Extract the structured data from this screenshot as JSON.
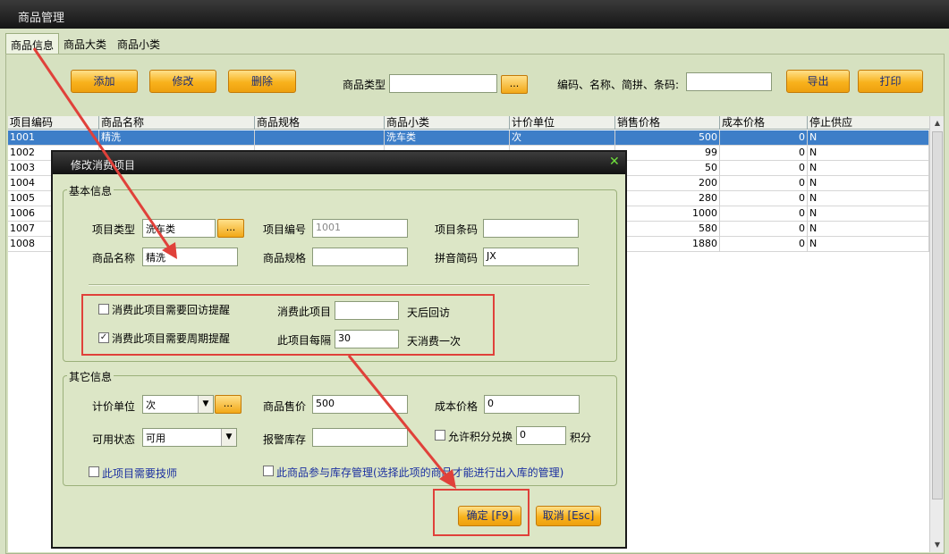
{
  "window": {
    "title": "商品管理"
  },
  "tabs": [
    "商品信息",
    "商品大类",
    "商品小类"
  ],
  "toolbar": {
    "add": "添加",
    "edit": "修改",
    "delete": "删除",
    "type_label": "商品类型",
    "browse": "...",
    "search_label": "编码、名称、简拼、条码:",
    "export": "导出",
    "print": "打印"
  },
  "grid": {
    "headers": [
      "项目编码",
      "商品名称",
      "商品规格",
      "商品小类",
      "计价单位",
      "销售价格",
      "成本价格",
      "停止供应"
    ],
    "rows": [
      [
        "1001",
        "精洗",
        "",
        "洗车类",
        "次",
        "500",
        "0",
        "N"
      ],
      [
        "1002",
        "",
        "",
        "",
        "",
        "99",
        "0",
        "N"
      ],
      [
        "1003",
        "",
        "",
        "",
        "",
        "50",
        "0",
        "N"
      ],
      [
        "1004",
        "",
        "",
        "",
        "",
        "200",
        "0",
        "N"
      ],
      [
        "1005",
        "",
        "",
        "",
        "",
        "280",
        "0",
        "N"
      ],
      [
        "1006",
        "",
        "",
        "",
        "",
        "1000",
        "0",
        "N"
      ],
      [
        "1007",
        "",
        "",
        "",
        "",
        "580",
        "0",
        "N"
      ],
      [
        "1008",
        "",
        "",
        "",
        "",
        "1880",
        "0",
        "N"
      ]
    ]
  },
  "dialog": {
    "title": "修改消费项目",
    "basic": {
      "legend": "基本信息",
      "type_label": "项目类型",
      "type_value": "洗车类",
      "browse": "...",
      "code_label": "项目编号",
      "code_value": "1001",
      "barcode_label": "项目条码",
      "barcode_value": "",
      "name_label": "商品名称",
      "name_value": "精洗",
      "spec_label": "商品规格",
      "spec_value": "",
      "pinyin_label": "拼音简码",
      "pinyin_value": "JX",
      "revisit_check": "消费此项目需要回访提醒",
      "revisit_checked": false,
      "revisit_label": "消费此项目",
      "revisit_value": "",
      "revisit_suffix": "天后回访",
      "cycle_check": "消费此项目需要周期提醒",
      "cycle_checked": true,
      "cycle_label": "此项目每隔",
      "cycle_value": "30",
      "cycle_suffix": "天消费一次"
    },
    "other": {
      "legend": "其它信息",
      "unit_label": "计价单位",
      "unit_value": "次",
      "browse": "...",
      "price_label": "商品售价",
      "price_value": "500",
      "cost_label": "成本价格",
      "cost_value": "0",
      "status_label": "可用状态",
      "status_value": "可用",
      "alarm_label": "报警库存",
      "alarm_value": "",
      "points_check": "允许积分兑换",
      "points_value": "0",
      "points_suffix": "积分",
      "tech_check": "此项目需要技师",
      "stock_check": "此商品参与库存管理(选择此项的商品才能进行出入库的管理)"
    },
    "ok": "确定 [F9]",
    "cancel": "取消 [Esc]"
  },
  "colors": {
    "annotation": "#e0413a",
    "accent_button": "#f8b21c",
    "selection": "#3d7ec8"
  },
  "icons": {
    "close": "close-icon",
    "dropdown": "chevron-down-icon",
    "check": "check-icon"
  }
}
